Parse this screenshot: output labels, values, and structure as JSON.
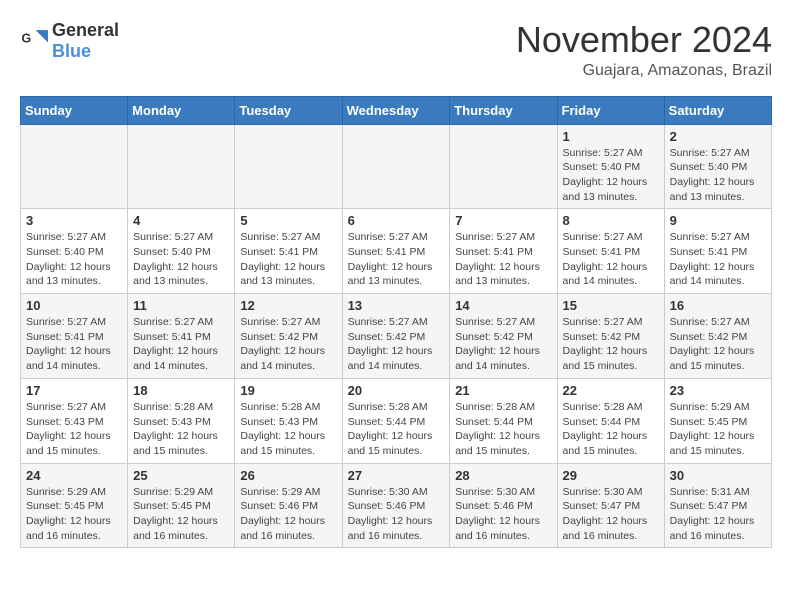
{
  "header": {
    "logo_general": "General",
    "logo_blue": "Blue",
    "month": "November 2024",
    "location": "Guajara, Amazonas, Brazil"
  },
  "days_of_week": [
    "Sunday",
    "Monday",
    "Tuesday",
    "Wednesday",
    "Thursday",
    "Friday",
    "Saturday"
  ],
  "weeks": [
    [
      {
        "day": "",
        "info": ""
      },
      {
        "day": "",
        "info": ""
      },
      {
        "day": "",
        "info": ""
      },
      {
        "day": "",
        "info": ""
      },
      {
        "day": "",
        "info": ""
      },
      {
        "day": "1",
        "info": "Sunrise: 5:27 AM\nSunset: 5:40 PM\nDaylight: 12 hours and 13 minutes."
      },
      {
        "day": "2",
        "info": "Sunrise: 5:27 AM\nSunset: 5:40 PM\nDaylight: 12 hours and 13 minutes."
      }
    ],
    [
      {
        "day": "3",
        "info": "Sunrise: 5:27 AM\nSunset: 5:40 PM\nDaylight: 12 hours and 13 minutes."
      },
      {
        "day": "4",
        "info": "Sunrise: 5:27 AM\nSunset: 5:40 PM\nDaylight: 12 hours and 13 minutes."
      },
      {
        "day": "5",
        "info": "Sunrise: 5:27 AM\nSunset: 5:41 PM\nDaylight: 12 hours and 13 minutes."
      },
      {
        "day": "6",
        "info": "Sunrise: 5:27 AM\nSunset: 5:41 PM\nDaylight: 12 hours and 13 minutes."
      },
      {
        "day": "7",
        "info": "Sunrise: 5:27 AM\nSunset: 5:41 PM\nDaylight: 12 hours and 13 minutes."
      },
      {
        "day": "8",
        "info": "Sunrise: 5:27 AM\nSunset: 5:41 PM\nDaylight: 12 hours and 14 minutes."
      },
      {
        "day": "9",
        "info": "Sunrise: 5:27 AM\nSunset: 5:41 PM\nDaylight: 12 hours and 14 minutes."
      }
    ],
    [
      {
        "day": "10",
        "info": "Sunrise: 5:27 AM\nSunset: 5:41 PM\nDaylight: 12 hours and 14 minutes."
      },
      {
        "day": "11",
        "info": "Sunrise: 5:27 AM\nSunset: 5:41 PM\nDaylight: 12 hours and 14 minutes."
      },
      {
        "day": "12",
        "info": "Sunrise: 5:27 AM\nSunset: 5:42 PM\nDaylight: 12 hours and 14 minutes."
      },
      {
        "day": "13",
        "info": "Sunrise: 5:27 AM\nSunset: 5:42 PM\nDaylight: 12 hours and 14 minutes."
      },
      {
        "day": "14",
        "info": "Sunrise: 5:27 AM\nSunset: 5:42 PM\nDaylight: 12 hours and 14 minutes."
      },
      {
        "day": "15",
        "info": "Sunrise: 5:27 AM\nSunset: 5:42 PM\nDaylight: 12 hours and 15 minutes."
      },
      {
        "day": "16",
        "info": "Sunrise: 5:27 AM\nSunset: 5:42 PM\nDaylight: 12 hours and 15 minutes."
      }
    ],
    [
      {
        "day": "17",
        "info": "Sunrise: 5:27 AM\nSunset: 5:43 PM\nDaylight: 12 hours and 15 minutes."
      },
      {
        "day": "18",
        "info": "Sunrise: 5:28 AM\nSunset: 5:43 PM\nDaylight: 12 hours and 15 minutes."
      },
      {
        "day": "19",
        "info": "Sunrise: 5:28 AM\nSunset: 5:43 PM\nDaylight: 12 hours and 15 minutes."
      },
      {
        "day": "20",
        "info": "Sunrise: 5:28 AM\nSunset: 5:44 PM\nDaylight: 12 hours and 15 minutes."
      },
      {
        "day": "21",
        "info": "Sunrise: 5:28 AM\nSunset: 5:44 PM\nDaylight: 12 hours and 15 minutes."
      },
      {
        "day": "22",
        "info": "Sunrise: 5:28 AM\nSunset: 5:44 PM\nDaylight: 12 hours and 15 minutes."
      },
      {
        "day": "23",
        "info": "Sunrise: 5:29 AM\nSunset: 5:45 PM\nDaylight: 12 hours and 15 minutes."
      }
    ],
    [
      {
        "day": "24",
        "info": "Sunrise: 5:29 AM\nSunset: 5:45 PM\nDaylight: 12 hours and 16 minutes."
      },
      {
        "day": "25",
        "info": "Sunrise: 5:29 AM\nSunset: 5:45 PM\nDaylight: 12 hours and 16 minutes."
      },
      {
        "day": "26",
        "info": "Sunrise: 5:29 AM\nSunset: 5:46 PM\nDaylight: 12 hours and 16 minutes."
      },
      {
        "day": "27",
        "info": "Sunrise: 5:30 AM\nSunset: 5:46 PM\nDaylight: 12 hours and 16 minutes."
      },
      {
        "day": "28",
        "info": "Sunrise: 5:30 AM\nSunset: 5:46 PM\nDaylight: 12 hours and 16 minutes."
      },
      {
        "day": "29",
        "info": "Sunrise: 5:30 AM\nSunset: 5:47 PM\nDaylight: 12 hours and 16 minutes."
      },
      {
        "day": "30",
        "info": "Sunrise: 5:31 AM\nSunset: 5:47 PM\nDaylight: 12 hours and 16 minutes."
      }
    ]
  ]
}
